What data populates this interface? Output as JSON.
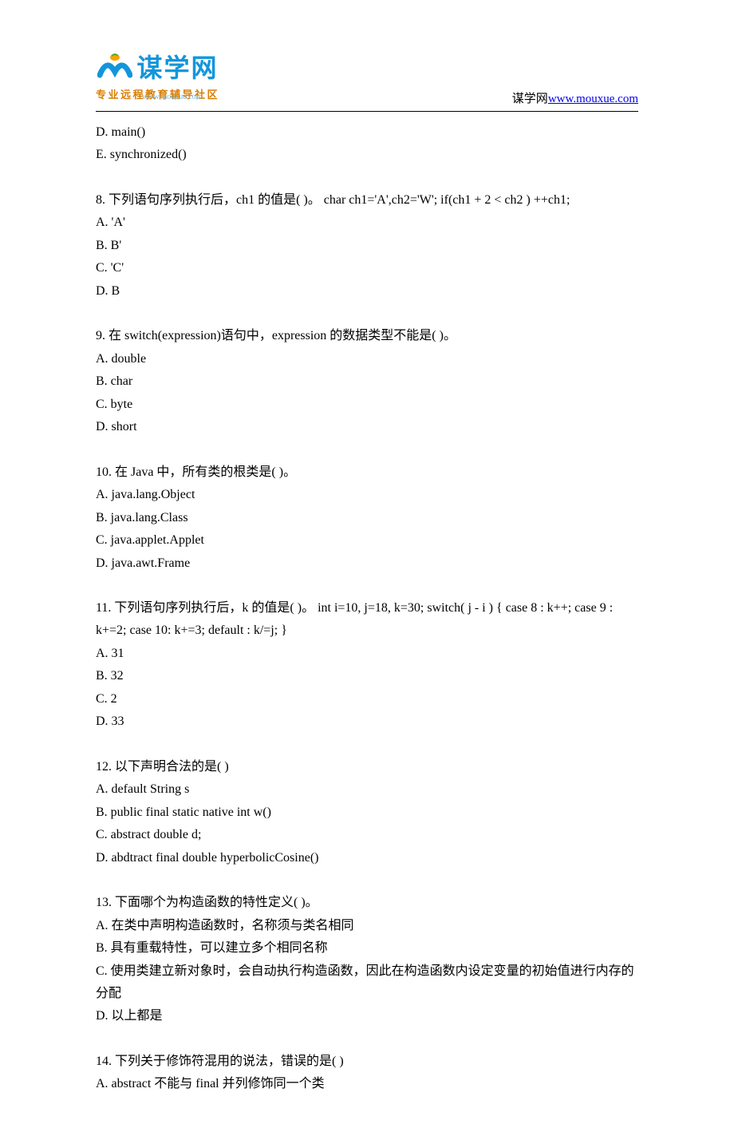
{
  "header": {
    "logo_text": "谋学网",
    "logo_sub": "专业远程教育辅导社区",
    "logo_url": "www.mouxue.com",
    "right_prefix": "谋学网",
    "right_link": "www.mouxue.com"
  },
  "questions": [
    {
      "continuation": [
        "D. main()",
        "E. synchronized()"
      ]
    },
    {
      "stem": "8.  下列语句序列执行后，ch1 的值是( )。 char ch1='A',ch2='W'; if(ch1 + 2 < ch2 ) ++ch1;",
      "options": [
        "A. 'A'",
        "B. B'",
        "C. 'C'",
        "D. B"
      ]
    },
    {
      "stem": "9.  在 switch(expression)语句中，expression 的数据类型不能是( )。",
      "options": [
        "A. double",
        "B. char",
        "C. byte",
        "D. short"
      ]
    },
    {
      "stem": "10.  在 Java 中，所有类的根类是( )。",
      "options": [
        "A. java.lang.Object",
        "B. java.lang.Class",
        "C. java.applet.Applet",
        "D. java.awt.Frame"
      ]
    },
    {
      "stem": "11.  下列语句序列执行后，k 的值是( )。 int i=10, j=18, k=30; switch( j - i ) { case 8 : k++; case 9 : k+=2; case 10: k+=3; default : k/=j; }",
      "options": [
        "A. 31",
        "B. 32",
        "C. 2",
        "D. 33"
      ]
    },
    {
      "stem": "12.  以下声明合法的是( )",
      "options": [
        "A. default String s",
        "B. public final static native int w()",
        "C. abstract double d;",
        "D. abdtract final double hyperbolicCosine()"
      ]
    },
    {
      "stem": "13.  下面哪个为构造函数的特性定义( )。",
      "options": [
        "A. 在类中声明构造函数时，名称须与类名相同",
        "B. 具有重载特性，可以建立多个相同名称",
        "C. 使用类建立新对象时，会自动执行构造函数，因此在构造函数内设定变量的初始值进行内存的分配",
        "D. 以上都是"
      ]
    },
    {
      "stem": "14.  下列关于修饰符混用的说法，错误的是( )",
      "options": [
        "A. abstract 不能与 final 并列修饰同一个类"
      ]
    }
  ]
}
